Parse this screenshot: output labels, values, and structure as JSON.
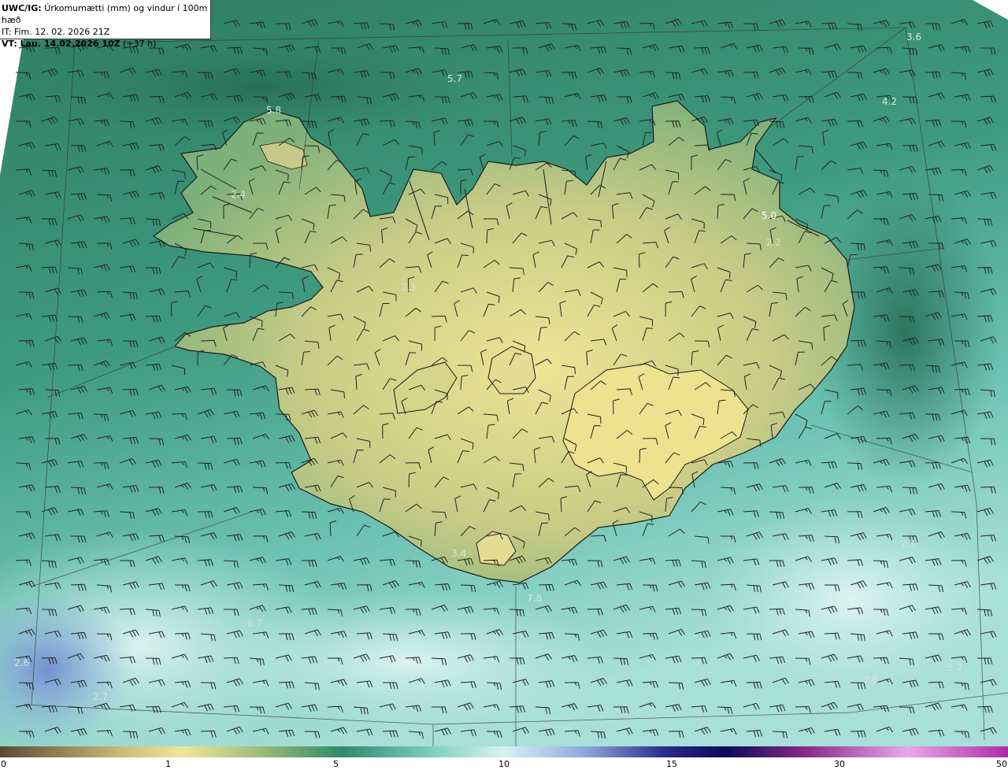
{
  "header": {
    "model_label": "UWC/IG:",
    "title": "Úrkomumætti (mm) og vindur í 100m hæð",
    "initial_time": "IT: Fim. 12. 02. 2026 21Z",
    "valid_label": "VT: Lau. 14.02.2026 10Z",
    "valid_offset": "(+37 h)"
  },
  "map_labels": [
    {
      "text": "3.6",
      "color": "#d8e4dc"
    },
    {
      "text": "5.7",
      "color": "#d8e4dc"
    },
    {
      "text": "4.2",
      "color": "#d8e4dc"
    },
    {
      "text": "5.8",
      "color": "#d8e4dc"
    },
    {
      "text": "2.4",
      "color": "#d8e4dc"
    },
    {
      "text": "5.0",
      "color": "#ffffff"
    },
    {
      "text": "2.2",
      "color": "#d8e4dc"
    },
    {
      "text": "2.1",
      "color": "#d8e4dc"
    },
    {
      "text": "3.4",
      "color": "#d8e4dc"
    },
    {
      "text": "7.8",
      "color": "#d8e4dc"
    },
    {
      "text": "7.7",
      "color": "#d8e4dc"
    },
    {
      "text": "6.7",
      "color": "#d8e4dc"
    },
    {
      "text": "7.5",
      "color": "#d8e4dc"
    },
    {
      "text": "2.6",
      "color": "#d8e4dc"
    },
    {
      "text": "2.7",
      "color": "#d8e4dc"
    },
    {
      "text": "7.6",
      "color": "#d8e4dc"
    },
    {
      "text": "5.2",
      "color": "#d8e4dc"
    }
  ],
  "colorbar": {
    "ticks": [
      "0",
      "1",
      "5",
      "10",
      "15",
      "30",
      "50"
    ],
    "colors": [
      "#5a4a32",
      "#c9bb78",
      "#f0e79a",
      "#9aba78",
      "#2e8a6c",
      "#7fcfc4",
      "#d8f2f2",
      "#8fa8dc",
      "#2a2a8a",
      "#0a0a5a",
      "#8a2a8a",
      "#e8a8e8",
      "#b02aa8"
    ]
  },
  "theme": {
    "sea_dark": "#2e8a6c",
    "sea_light": "#8fd0c8",
    "land_dry": "#e6df92",
    "land_wet": "#6fa874",
    "coast": "#1a1a1a",
    "barb": "#222222"
  }
}
